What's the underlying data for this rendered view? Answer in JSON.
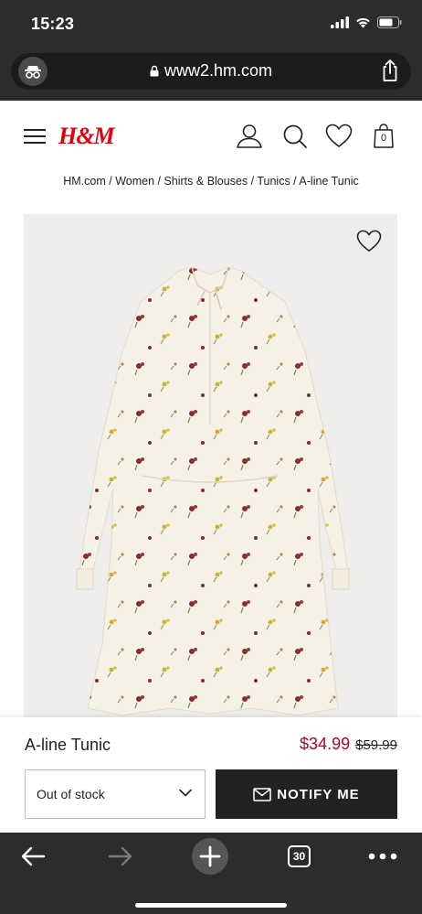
{
  "status_bar": {
    "time": "15:23"
  },
  "browser": {
    "url": "www2.hm.com",
    "tab_count": "30",
    "icons": {
      "incognito": "incognito-icon",
      "lock": "lock-icon",
      "share": "share-icon",
      "back": "back-arrow-icon",
      "forward": "forward-arrow-icon",
      "new_tab": "plus-icon",
      "more": "more-dots-icon"
    }
  },
  "header": {
    "logo": "H&M",
    "icons": [
      "menu-icon",
      "account-icon",
      "search-icon",
      "favorites-icon",
      "bag-icon"
    ],
    "bag_count": "0",
    "brand_color": "#e50010"
  },
  "breadcrumb": "HM.com / Women / Shirts & Blouses / Tunics / A-line Tunic",
  "product": {
    "name": "A-line Tunic",
    "sale_price": "$34.99",
    "original_price": "$59.99",
    "sale_color": "#b0002d",
    "size_select": {
      "selected": "Out of stock"
    },
    "notify_label": "NOTIFY ME"
  }
}
